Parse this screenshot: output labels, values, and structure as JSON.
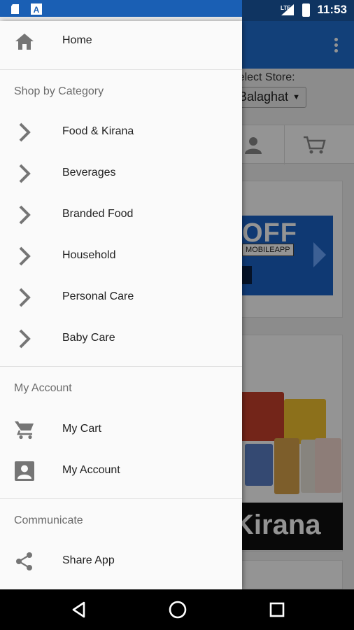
{
  "status_bar": {
    "time": "11:53",
    "network": "LTE"
  },
  "background_app": {
    "select_store_label": "Select Store:",
    "store_value": "Balaghat",
    "banner_offer": "OFF",
    "banner_code": "MOBILEAPP",
    "category_banner_text": "Kirana"
  },
  "drawer": {
    "home": "Home",
    "shop_section": "Shop by Category",
    "categories": [
      {
        "label": "Food & Kirana"
      },
      {
        "label": "Beverages"
      },
      {
        "label": "Branded Food"
      },
      {
        "label": "Household"
      },
      {
        "label": "Personal Care"
      },
      {
        "label": "Baby Care"
      }
    ],
    "account_section": "My Account",
    "my_cart": "My Cart",
    "my_account": "My Account",
    "communicate_section": "Communicate",
    "share_app": "Share App"
  },
  "colors": {
    "primary": "#1f6fd0",
    "status_bar": "#1a5fb4",
    "drawer_bg": "#fafafa",
    "icon_grey": "#757575"
  },
  "icons": [
    "home-icon",
    "chevron-right-icon",
    "cart-icon",
    "account-box-icon",
    "share-icon",
    "back-icon",
    "home-circle-icon",
    "recents-icon"
  ]
}
